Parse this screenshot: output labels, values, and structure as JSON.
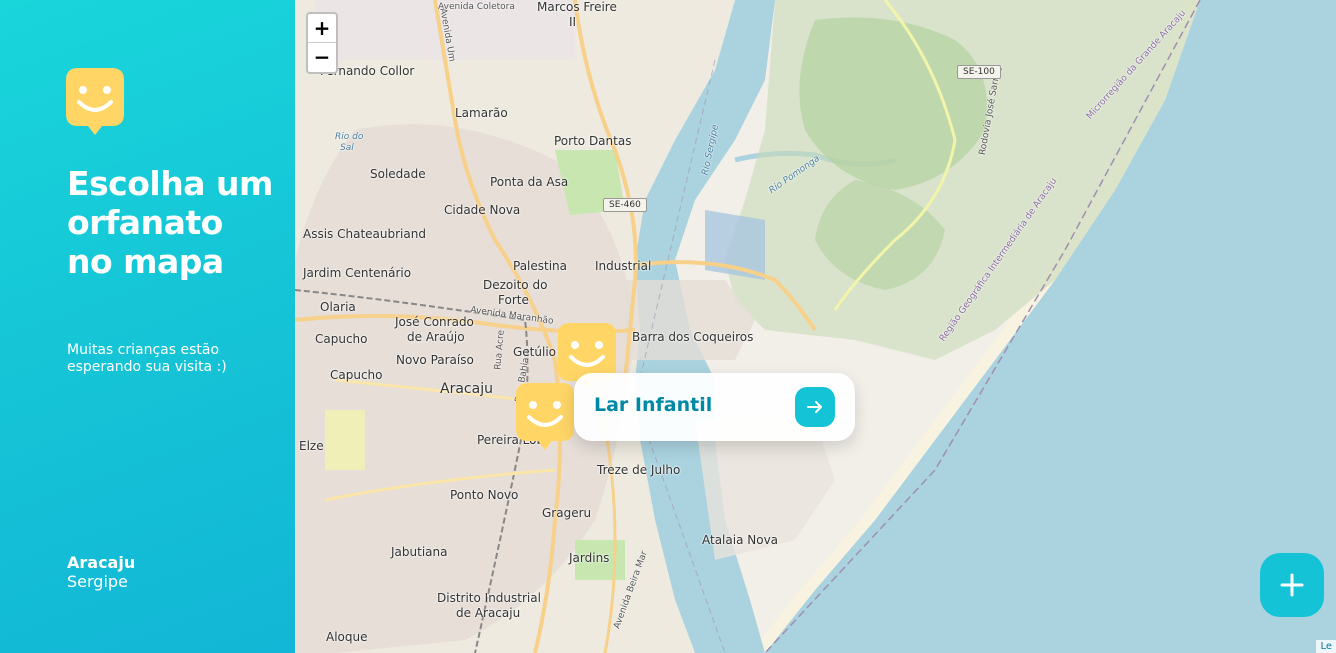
{
  "sidebar": {
    "title": "Escolha um orfanato no mapa",
    "subtitle": "Muitas crianças estão esperando sua visita :)",
    "city": "Aracaju",
    "state": "Sergipe"
  },
  "map": {
    "zoom_in": "+",
    "zoom_out": "−",
    "labels": {
      "avenida_coletora": "Avenida Coletora",
      "marcos_freire": "Marcos Freire",
      "marcos_freire_ii": "II",
      "fernando_collor": "Fernando Collor",
      "lamarao": "Lamarão",
      "porto_dantas": "Porto Dantas",
      "soledade": "Soledade",
      "ponta_da_asa": "Ponta da Asa",
      "cidade_nova": "Cidade Nova",
      "assis": "Assis Chateaubriand",
      "jardim_centenario": "Jardim Centenário",
      "palestina": "Palestina",
      "industrial": "Industrial",
      "dezoito_do_forte": "Dezoito do",
      "dezoito_do_forte_2": "Forte",
      "olaria": "Olaria",
      "jose_conrado": "José Conrado",
      "jose_conrado_2": "de Araújo",
      "capucho": "Capucho",
      "getulio": "Getúlio",
      "novo_paraiso": "Novo Paraíso",
      "capucho2": "Capucho",
      "aracaju": "Aracaju",
      "barra": "Barra dos Coqueiros",
      "elze": "Elze",
      "pereira_lobo": "Pereira Lobo",
      "treze_de_julho": "Treze de Julho",
      "ponto_novo": "Ponto Novo",
      "grageru": "Grageru",
      "jabutiana": "Jabutiana",
      "jardins": "Jardins",
      "atalaia_nova": "Atalaia Nova",
      "distrito_industrial": "Distrito Industrial",
      "distrito_industrial_2": "de Aracaju",
      "aloque": "Aloque",
      "rio_do_sal": "Rio do",
      "rio_do_sal_2": "Sal",
      "rio_sergipe": "Rio Sergipe",
      "rio_pomonga": "Rio Pomonga",
      "rodovia": "Rodovia José Sarney",
      "microrregiao": "Microrregião da Grande Aracaju",
      "regiao": "Região Geográfica Intermediária de Aracaju",
      "av_maranhao": "Avenida Maranhão",
      "av_acre": "Rua Acre",
      "av_bahia": "Rua Bahia",
      "av_beira_mar": "Avenida Beira Mar",
      "av_um": "Avenida Um"
    },
    "shields": {
      "se460": "SE-460",
      "se100": "SE-100"
    },
    "attribution": "Le"
  },
  "popup": {
    "title": "Lar Infantil"
  },
  "colors": {
    "accent": "#15c3d6",
    "marker": "#ffd666",
    "popup_text": "#0089a5",
    "water": "#aad3df",
    "land": "#f2efe9"
  }
}
